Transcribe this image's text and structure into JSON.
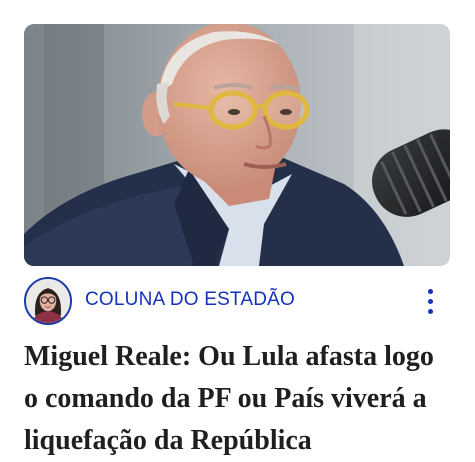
{
  "hero": {
    "icon": "news-photo"
  },
  "source": {
    "name": "COLUNA DO ESTADÃO",
    "avatar_icon": "author-avatar",
    "more_icon": "more-vertical-icon",
    "accent_color": "#1433b8"
  },
  "article": {
    "headline": "Miguel Reale: Ou Lula afasta logo o comando da PF ou País viverá a liquefação da República"
  }
}
